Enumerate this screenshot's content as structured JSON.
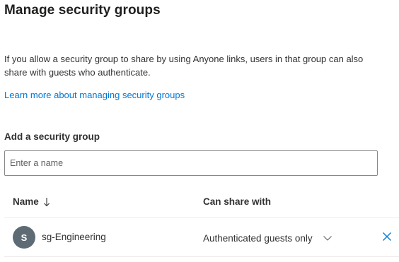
{
  "title": "Manage security groups",
  "description": "If you allow a security group to share by using Anyone links, users in that group can also share with guests who authenticate.",
  "learn_more_link": "Learn more about managing security groups",
  "add_group": {
    "label": "Add a security group",
    "placeholder": "Enter a name",
    "value": ""
  },
  "table": {
    "columns": {
      "name": "Name",
      "can_share_with": "Can share with"
    },
    "sort": {
      "column": "name",
      "direction": "descending"
    },
    "rows": [
      {
        "avatar_initial": "S",
        "name": "sg-Engineering",
        "can_share_with": "Authenticated guests only"
      }
    ]
  },
  "colors": {
    "link": "#0078d4",
    "avatar_bg": "#5f6b74",
    "remove_icon": "#0078d4",
    "divider": "#edebe9",
    "input_border": "#8a8886"
  },
  "icons": {
    "sort": "arrow-down-icon",
    "dropdown": "chevron-down-icon",
    "remove": "close-icon"
  }
}
